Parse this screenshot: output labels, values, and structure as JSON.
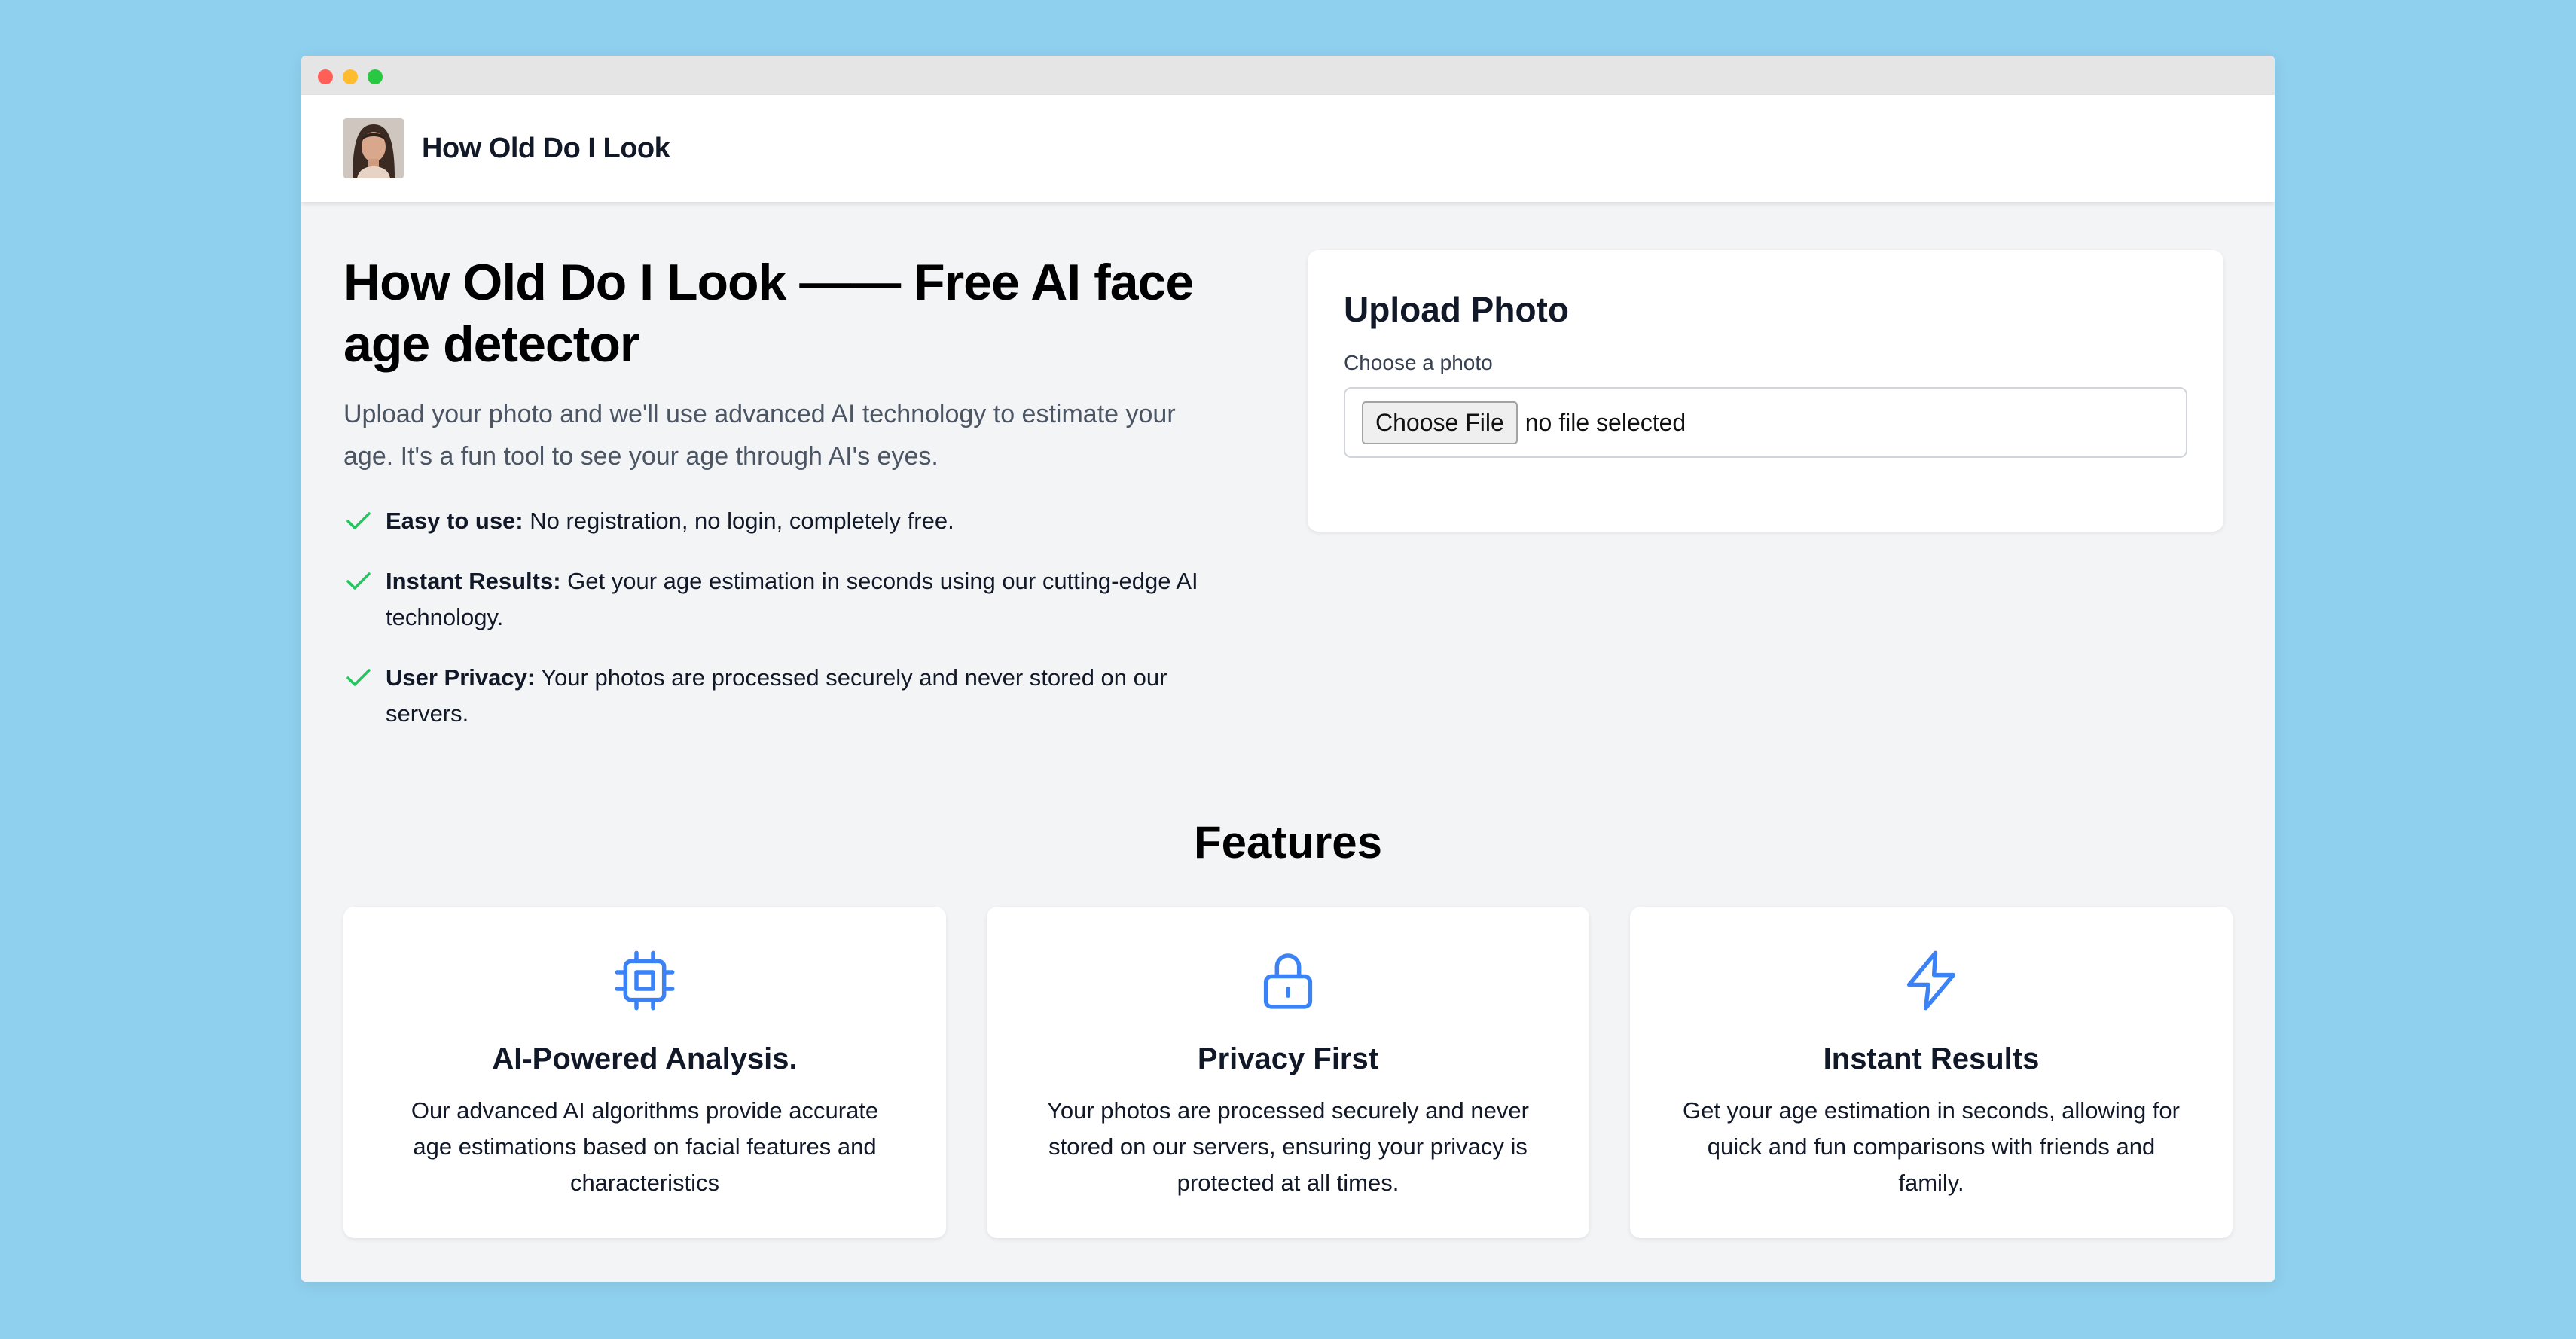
{
  "window": {},
  "navbar": {
    "brand": "How Old Do I Look"
  },
  "hero": {
    "title": "How Old Do I Look —— Free AI face age detector",
    "subtitle": "Upload your photo and we'll use advanced AI technology to estimate your age. It's a fun tool to see your age through AI's eyes.",
    "bullets": [
      {
        "title": "Easy to use:",
        "text": " No registration, no login, completely free."
      },
      {
        "title": "Instant Results:",
        "text": " Get your age estimation in seconds using our cutting-edge AI technology."
      },
      {
        "title": "User Privacy:",
        "text": " Your photos are processed securely and never stored on our servers."
      }
    ]
  },
  "upload": {
    "title": "Upload Photo",
    "label": "Choose a photo",
    "button": "Choose File",
    "status": "no file selected"
  },
  "features": {
    "heading": "Features",
    "items": [
      {
        "icon": "cpu-chip-icon",
        "title": "AI-Powered Analysis.",
        "text": "Our advanced AI algorithms provide accurate age estimations based on facial features and characteristics"
      },
      {
        "icon": "lock-icon",
        "title": "Privacy First",
        "text": "Your photos are processed securely and never stored on our servers, ensuring your privacy is protected at all times."
      },
      {
        "icon": "lightning-bolt-icon",
        "title": "Instant Results",
        "text": "Get your age estimation in seconds, allowing for quick and fun comparisons with friends and family."
      }
    ]
  },
  "colors": {
    "accent": "#3b82f6",
    "check": "#22c55e",
    "background": "#8fd0ee"
  }
}
